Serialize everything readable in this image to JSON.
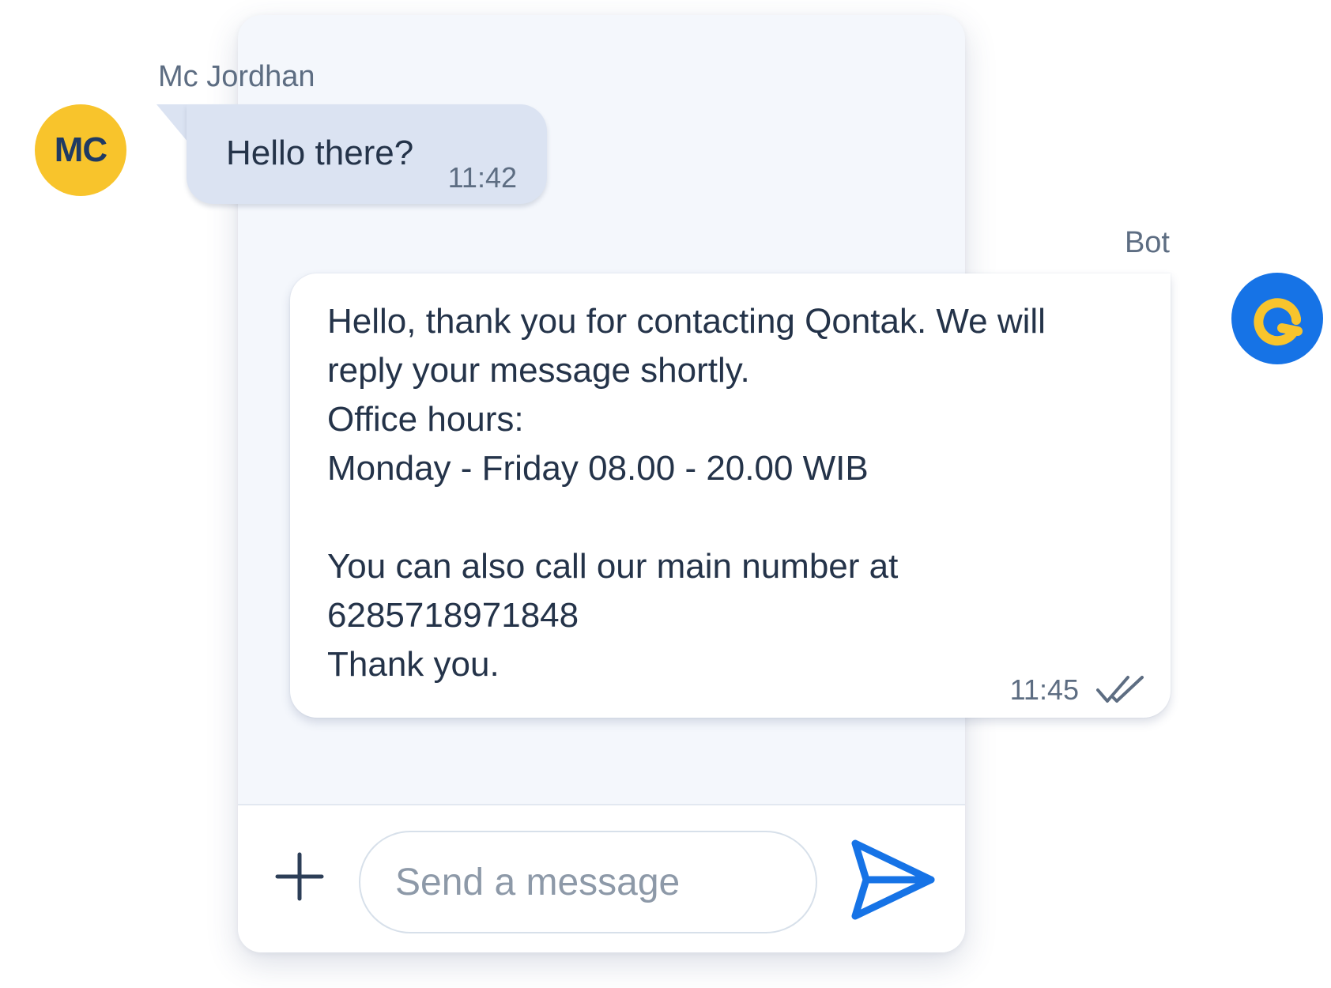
{
  "composer": {
    "placeholder": "Send a message",
    "add_icon": "plus-icon",
    "send_icon": "send-icon"
  },
  "messages": [
    {
      "sender": "Mc Jordhan",
      "avatar_initials": "MC",
      "avatar_color": "#f8c42c",
      "text": "Hello there?",
      "time": "11:42",
      "direction": "incoming"
    },
    {
      "sender": "Bot",
      "avatar_icon": "qontak-logo-icon",
      "avatar_color": "#1673e6",
      "text": "Hello, thank you for contacting Qontak. We will\nreply your message shortly.\nOffice hours:\nMonday - Friday 08.00 - 20.00 WIB\n\nYou can also call our main number at\n6285718971848\nThank you.",
      "time": "11:45",
      "status_icon": "double-check-icon",
      "direction": "outgoing"
    }
  ],
  "colors": {
    "accent": "#1673e6",
    "incoming_bubble": "#dbe3f2",
    "outgoing_bubble": "#ffffff",
    "panel_background": "#f4f7fc"
  }
}
